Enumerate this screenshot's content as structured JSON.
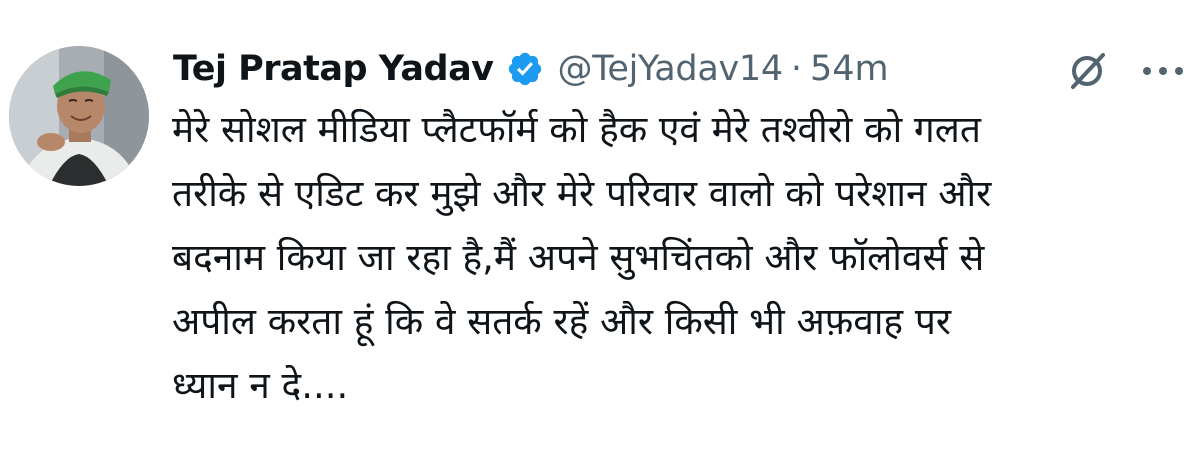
{
  "tweet": {
    "author": {
      "display_name": "Tej Pratap Yadav",
      "handle": "@TejYadav14",
      "verified": true,
      "avatar_icon": "profile-photo-avatar"
    },
    "separator": "·",
    "timestamp": "54m",
    "text_lines": [
      "मेरे सोशल मीडिया प्लैटफॉर्म को हैक एवं मेरे तश्वीरो को गलत",
      "तरीके से एडिट कर मुझे और मेरे परिवार वालो को परेशान और",
      "बदनाम किया जा रहा है,मैं अपने सुभचिंतको और फॉलोवर्स से",
      "अपील करता हूं कि वे सतर्क रहें और किसी भी अफ़वाह पर",
      "ध्यान न दे...."
    ],
    "icons": {
      "verified": "verified-badge-icon",
      "grok": "grok-icon",
      "more": "more-options-icon"
    }
  },
  "colors": {
    "text_primary": "#0f1419",
    "text_secondary": "#536471",
    "verified_blue": "#1d9bf0",
    "background": "#ffffff"
  }
}
